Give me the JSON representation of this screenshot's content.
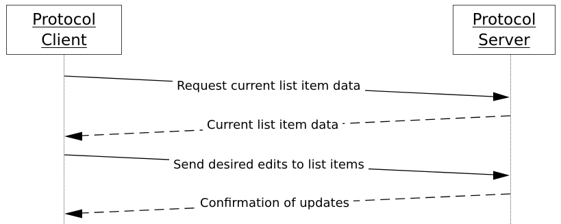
{
  "participants": {
    "client": {
      "line1": "Protocol",
      "line2": "Client"
    },
    "server": {
      "line1": "Protocol",
      "line2": "Server"
    }
  },
  "messages": [
    {
      "label": "Request current list item data",
      "from": "client",
      "to": "server",
      "style": "solid"
    },
    {
      "label": "Current list item data",
      "from": "server",
      "to": "client",
      "style": "dashed"
    },
    {
      "label": "Send desired edits to list items",
      "from": "client",
      "to": "server",
      "style": "solid"
    },
    {
      "label": "Confirmation of updates",
      "from": "server",
      "to": "client",
      "style": "dashed"
    }
  ],
  "colors": {
    "line": "#000000",
    "box_border": "#444444",
    "lifeline": "#555555"
  }
}
